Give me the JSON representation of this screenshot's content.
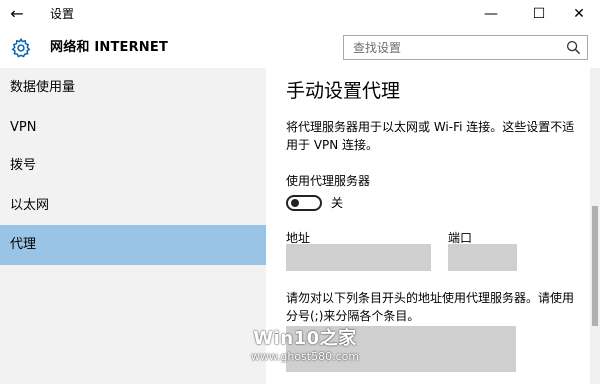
{
  "window": {
    "title": "设置",
    "back_glyph": "←",
    "minimize_glyph": "—",
    "maximize_glyph": "☐",
    "close_glyph": "✕"
  },
  "header": {
    "title": "网络和 INTERNET",
    "icon": "gear-icon"
  },
  "search": {
    "placeholder": "查找设置",
    "value": "",
    "icon": "search-icon"
  },
  "sidebar": {
    "items": [
      {
        "label": "数据使用量",
        "active": false
      },
      {
        "label": "VPN",
        "active": false
      },
      {
        "label": "拨号",
        "active": false
      },
      {
        "label": "以太网",
        "active": false
      },
      {
        "label": "代理",
        "active": true
      }
    ]
  },
  "main": {
    "heading": "手动设置代理",
    "description": "将代理服务器用于以太网或 Wi-Fi 连接。这些设置不适用于 VPN 连接。",
    "use_proxy_label": "使用代理服务器",
    "toggle_state": "关",
    "toggle_on": false,
    "address_label": "地址",
    "address_value": "",
    "port_label": "端口",
    "port_value": "",
    "exceptions_description": "请勿对以下列条目开头的地址使用代理服务器。请使用分号(;)来分隔各个条目。",
    "exceptions_value": ""
  },
  "watermark": {
    "main": "Win10之家",
    "sub": "www.ghost580.com"
  },
  "colors": {
    "sidebar_bg": "#f2f2f2",
    "active_item_bg": "#99c4e6",
    "field_bg": "#cfcfcf"
  }
}
